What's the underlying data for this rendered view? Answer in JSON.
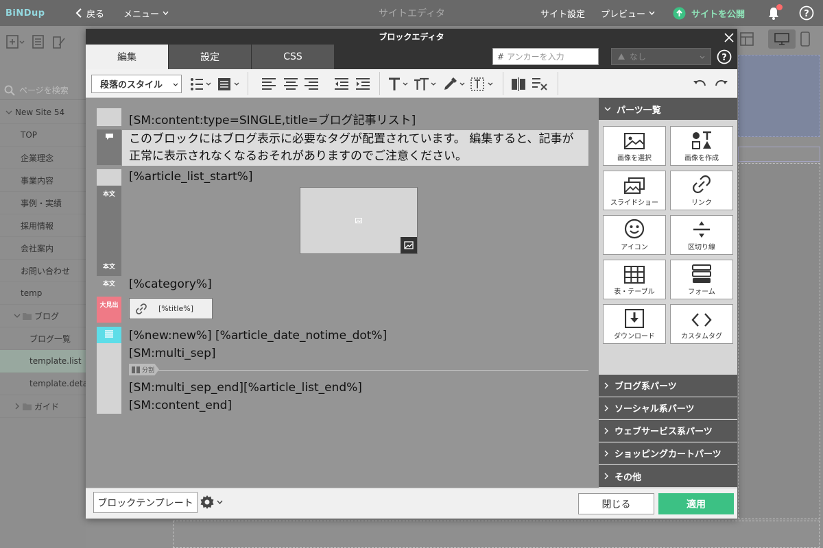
{
  "topbar": {
    "logo": "BiNDup",
    "back": "戻る",
    "menu": "メニュー",
    "title": "サイトエディタ",
    "site_settings": "サイト設定",
    "preview": "プレビュー",
    "publish": "サイトを公開"
  },
  "sidebar": {
    "search_placeholder": "ページを検索",
    "site_name": "New Site 54",
    "pages": [
      "TOP",
      "企業理念",
      "事業内容",
      "事例・実績",
      "採用情報",
      "会社案内",
      "お問い合わせ",
      "temp"
    ],
    "blog_folder": "ブログ",
    "blog_pages": [
      "ブログ一覧",
      "template.list",
      "template.detail"
    ],
    "guide_folder": "ガイド"
  },
  "modal": {
    "title": "ブロックエディタ",
    "tabs": [
      "編集",
      "設定",
      "CSS"
    ],
    "anchor_placeholder": "アンカーを入力",
    "anchor_symbol": "#",
    "class_select": "なし",
    "paragraph_style": "段落のスタイル"
  },
  "editor": {
    "line1": "[SM:content:type=SINGLE,title=ブログ記事リスト]",
    "notice": "このブロックにはブログ表示に必要なタグが配置されています。 編集すると、記事が正常に表示されなくなるおそれがありますのでご注意ください。",
    "article_list_start": "[%article_list_start%]",
    "category": "[%category%]",
    "title_link": "[%title%]",
    "new_date": "[%new:new%] [%article_date_notime_dot%]",
    "multi_sep": "[SM:multi_sep]",
    "divider_label": "分割",
    "multi_sep_end": "[SM:multi_sep_end][%article_list_end%]",
    "content_end": "[SM:content_end]",
    "gutter_honbun": "本文",
    "gutter_midashi": "大見出"
  },
  "panel": {
    "title": "パーツ一覧",
    "parts": [
      "画像を選択",
      "画像を作成",
      "スライドショー",
      "リンク",
      "アイコン",
      "区切り線",
      "表・テーブル",
      "フォーム",
      "ダウンロード",
      "カスタムタグ"
    ],
    "sections": [
      "ブログ系パーツ",
      "ソーシャル系パーツ",
      "ウェブサービス系パーツ",
      "ショッピングカートパーツ",
      "その他"
    ]
  },
  "footer": {
    "template": "ブロックテンプレート",
    "close": "閉じる",
    "apply": "適用"
  },
  "colors": {
    "accent_green": "#3cc184",
    "logo_teal": "#93d8df",
    "heading_pink": "#ef7a86",
    "list_cyan": "#5ddde8"
  }
}
